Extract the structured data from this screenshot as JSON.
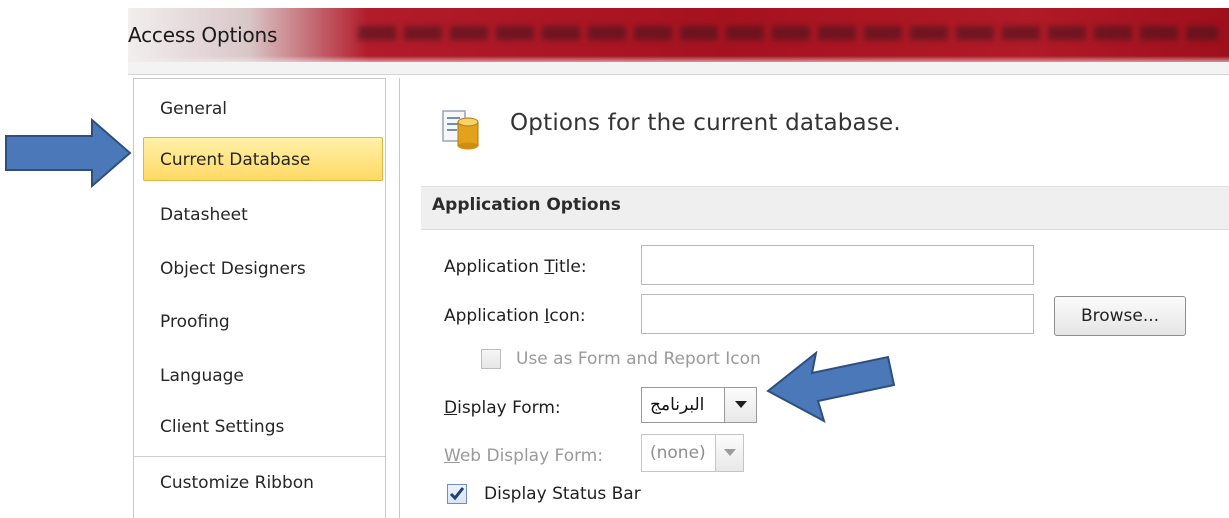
{
  "window": {
    "title": "Access Options"
  },
  "nav": {
    "items": [
      {
        "label": "General"
      },
      {
        "label": "Current Database"
      },
      {
        "label": "Datasheet"
      },
      {
        "label": "Object Designers"
      },
      {
        "label": "Proofing"
      },
      {
        "label": "Language"
      },
      {
        "label": "Client Settings"
      },
      {
        "label": "Customize Ribbon"
      }
    ],
    "selected": "Current Database"
  },
  "main": {
    "header": "Options for the current database.",
    "header_icon": "database-options-icon",
    "section": "Application Options",
    "app_title": {
      "label_pre": "Application ",
      "label_key": "T",
      "label_post": "itle:",
      "value": ""
    },
    "app_icon": {
      "label_pre": "Application ",
      "label_key": "I",
      "label_post": "con:",
      "value": ""
    },
    "browse_label": "Browse...",
    "use_as_icon": {
      "label": "Use as Form and Report Icon",
      "checked": false,
      "enabled": false
    },
    "display_form": {
      "label_key": "D",
      "label_post": "isplay Form:",
      "value": "البرنامج"
    },
    "web_display_form": {
      "label_key": "W",
      "label_post": "eb Display Form:",
      "value": "(none)",
      "enabled": false
    },
    "status_bar": {
      "label": "Display Status Bar",
      "checked": true
    }
  },
  "annotations": {
    "arrow_color": "#4a78b8",
    "arrow_border": "#2e4f7e"
  }
}
